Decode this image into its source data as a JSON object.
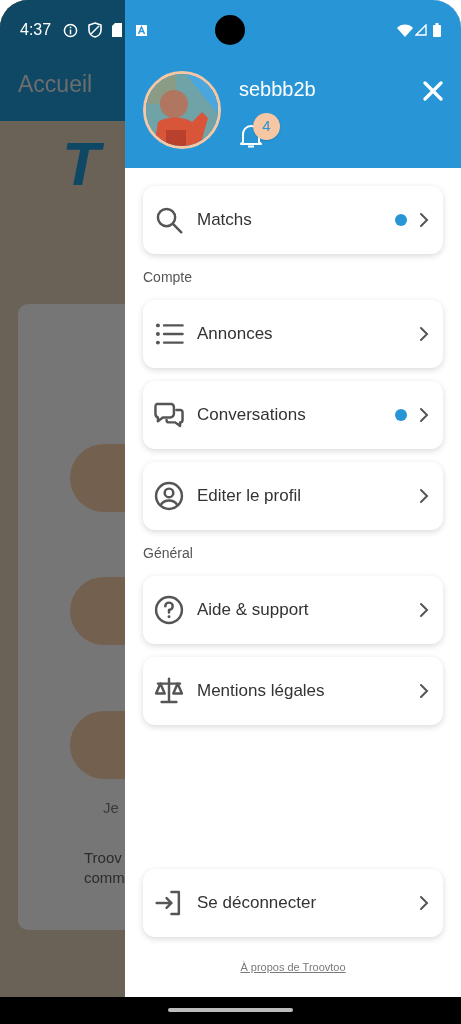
{
  "status_bar": {
    "time": "4:37"
  },
  "background": {
    "title": "Accueil",
    "logo": "T",
    "text_1": "Je",
    "text_2": "Troov",
    "text_3": "comm"
  },
  "drawer": {
    "username": "sebbb2b",
    "notifications": "4",
    "sections": [
      {
        "items": [
          {
            "kind": "search",
            "label": "Matchs",
            "unread": true
          }
        ]
      },
      {
        "title": "Compte",
        "items": [
          {
            "kind": "list",
            "label": "Annonces",
            "unread": false
          },
          {
            "kind": "chat",
            "label": "Conversations",
            "unread": true
          },
          {
            "kind": "user",
            "label": "Editer le profil",
            "unread": false
          }
        ]
      },
      {
        "title": "Général",
        "items": [
          {
            "kind": "help",
            "label": "Aide & support",
            "unread": false
          },
          {
            "kind": "scale",
            "label": "Mentions légales",
            "unread": false
          }
        ]
      }
    ],
    "logout": {
      "label": "Se déconnecter"
    },
    "about_link": "À propos de Troovtoo"
  }
}
